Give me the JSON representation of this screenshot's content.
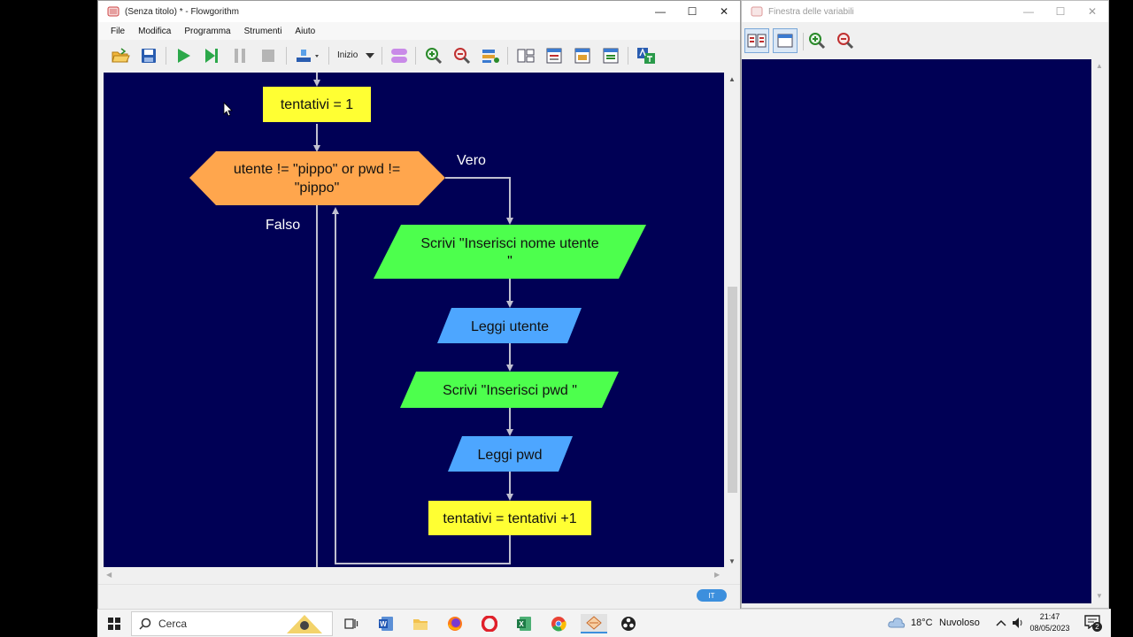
{
  "main_window": {
    "title": "(Senza titolo) * - Flowgorithm",
    "menu": [
      "File",
      "Modifica",
      "Programma",
      "Strumenti",
      "Aiuto"
    ],
    "toolbar": {
      "speed_label": "Inizio"
    },
    "language_badge": "IT"
  },
  "flowchart": {
    "assign_tentativi": "tentativi = 1",
    "condition_line1": "utente != \"pippo\" or pwd !=",
    "condition_line2": "\"pippo\"",
    "true_label": "Vero",
    "false_label": "Falso",
    "output1_line1": "Scrivi \"Inserisci nome utente",
    "output1_line2": "\"",
    "input_utente": "Leggi utente",
    "output2": "Scrivi \"Inserisci pwd  \"",
    "input_pwd": "Leggi pwd",
    "assign_increment": "tentativi = tentativi +1"
  },
  "vars_window": {
    "title": "Finestra delle variabili"
  },
  "taskbar": {
    "search_placeholder": "Cerca",
    "weather_temp": "18°C",
    "weather_desc": "Nuvoloso",
    "time": "21:47",
    "date": "08/05/2023",
    "notification_count": "2"
  },
  "colors": {
    "canvas_bg": "#000055",
    "assign": "#ffff33",
    "decision": "#ffa64d",
    "output": "#4dff4d",
    "input": "#4da6ff",
    "connector": "#c0c0d0"
  }
}
